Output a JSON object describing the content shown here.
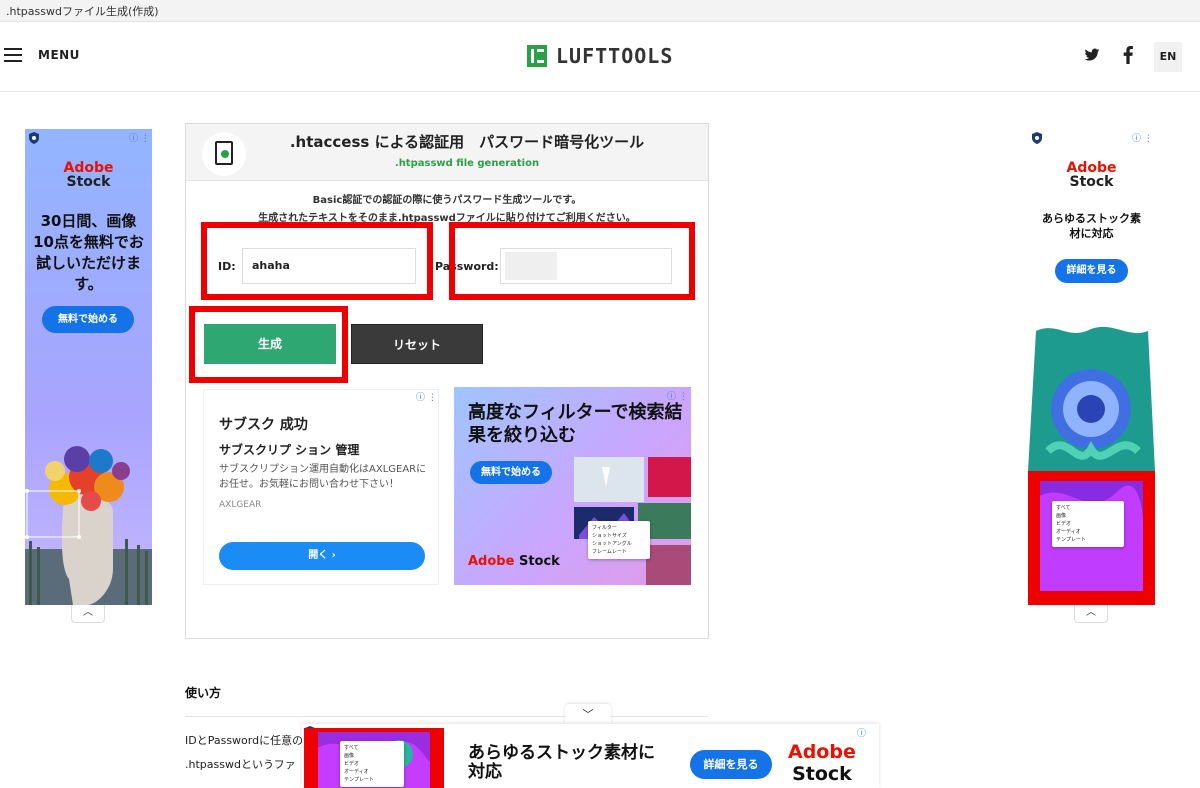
{
  "window": {
    "title": ".htpasswdファイル生成(作成)"
  },
  "header": {
    "menu_label": "MENU",
    "logo_text": "LUFTTOOLS",
    "lang": "EN",
    "icons": [
      "menu-icon",
      "twitter-icon",
      "facebook-icon"
    ]
  },
  "tool": {
    "title": ".htaccess による認証用　パスワード暗号化ツール",
    "subtitle": ".htpasswd file generation",
    "desc_1": "Basic認証での認証の際に使うパスワード生成ツールです。",
    "desc_2": "生成されたテキストをそのまま.htpasswdファイルに貼り付けてご利用ください。",
    "id_label": "ID:",
    "id_value": "ahaha",
    "password_label": "Password:",
    "password_value": "",
    "generate_label": "生成",
    "reset_label": "リセット",
    "accent_color": "#2ea773",
    "highlight_color": "#ee0000"
  },
  "ads": {
    "left": {
      "brand_1": "Adobe",
      "brand_2": "Stock",
      "headline": "30日間、画像10点を無料でお試しいただけます。",
      "cta": "無料で始める"
    },
    "right": {
      "brand_1": "Adobe",
      "brand_2": "Stock",
      "headline": "あらゆるストック素材に対応",
      "cta": "詳細を見る",
      "menu_items": [
        "すべて",
        "画像",
        "ビデオ",
        "オーディオ",
        "テンプレート"
      ]
    },
    "inner_text": {
      "title": "サブスク 成功",
      "subtitle": "サブスクリプ ション 管理",
      "body": "サブスクリプション運用自動化はAXLGEARにお任せ。お気軽にお問い合わせ下さい！",
      "advertiser": "AXLGEAR",
      "cta": "開く ›"
    },
    "inner_image": {
      "headline": "高度なフィルターで検索結果を絞り込む",
      "cta": "無料で始める",
      "brand_1": "Adobe",
      "brand_2": "Stock",
      "menu_items": [
        "フィルター",
        "ショットサイズ",
        "ショットアングル",
        "フレームレート"
      ]
    },
    "bottom": {
      "headline": "あらゆるストック素材に対応",
      "cta": "詳細を見る",
      "brand_1": "Adobe",
      "brand_2": "Stock",
      "menu_items": [
        "すべて",
        "画像",
        "ビデオ",
        "オーディオ",
        "テンプレート"
      ]
    }
  },
  "usage": {
    "title": "使い方",
    "line_1": "IDとPasswordに任意の",
    "line_2": ".htpasswdというファ"
  }
}
